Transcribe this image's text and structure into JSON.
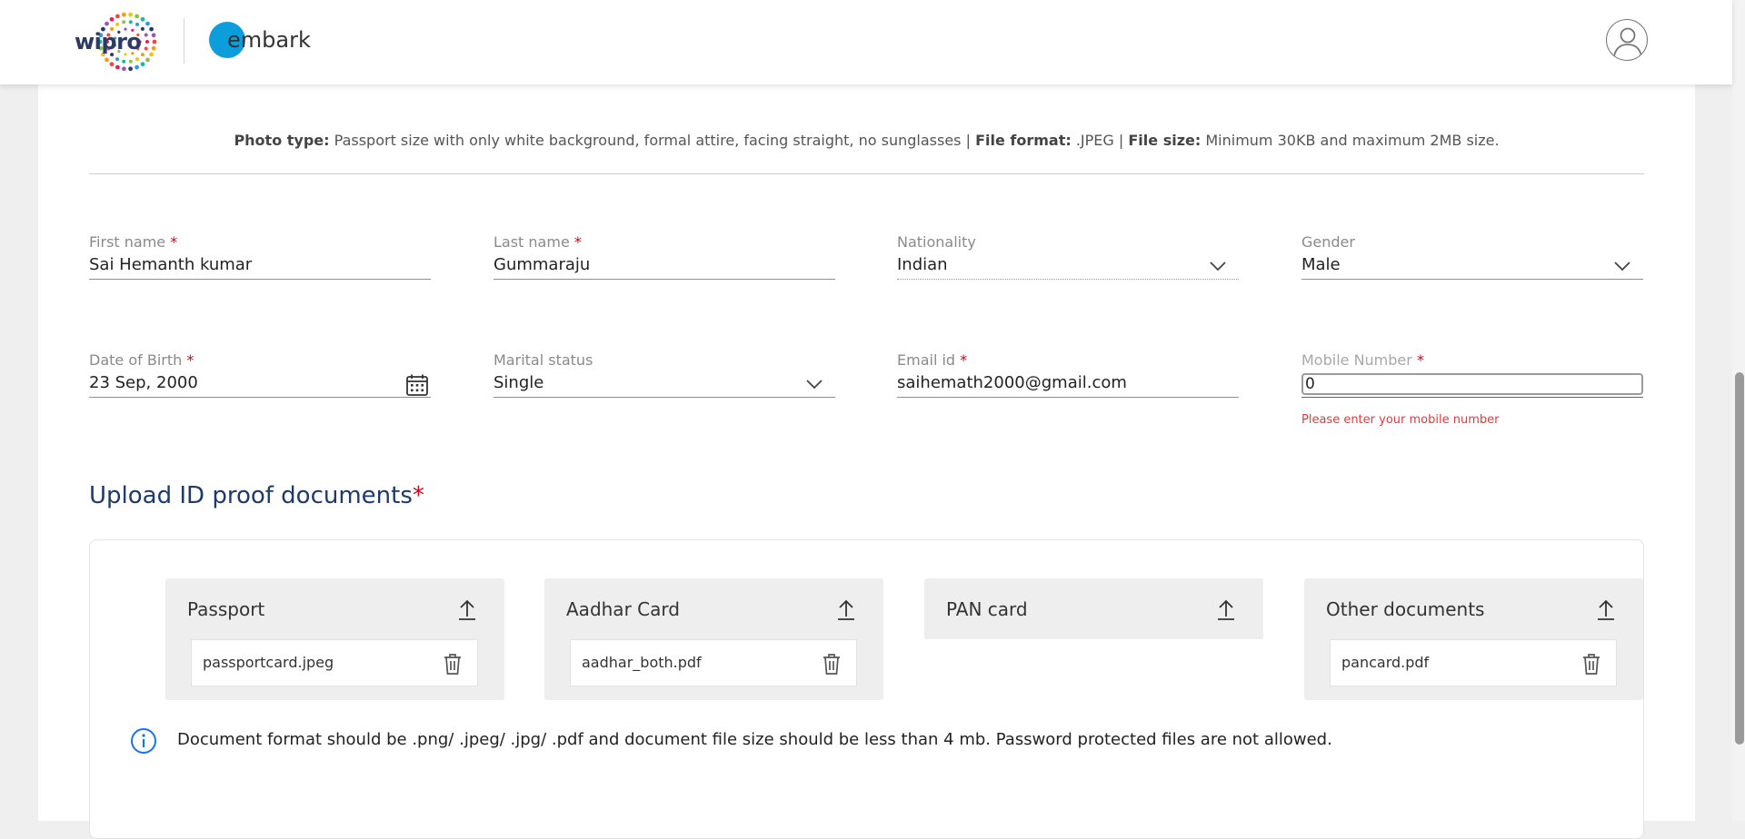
{
  "header": {
    "company_logo_text": "wipro",
    "app_name": "embark",
    "accent_color": "#0d9ddb"
  },
  "photo_note": {
    "type_label": "Photo type:",
    "type_value": "Passport size with only white background, formal attire, facing straight, no sunglasses |",
    "format_label": "File format:",
    "format_value": ".JPEG |",
    "size_label": "File size:",
    "size_value": "Minimum 30KB and maximum 2MB size."
  },
  "form": {
    "first_name": {
      "label": "First name",
      "required_mark": "*",
      "value": "Sai Hemanth kumar"
    },
    "last_name": {
      "label": "Last name",
      "required_mark": "*",
      "value": "Gummaraju"
    },
    "nationality": {
      "label": "Nationality",
      "value": "Indian"
    },
    "gender": {
      "label": "Gender",
      "value": "Male"
    },
    "dob": {
      "label": "Date of Birth",
      "required_mark": "*",
      "value": "23  Sep, 2000"
    },
    "marital_status": {
      "label": "Marital status",
      "value": "Single"
    },
    "email": {
      "label": "Email id",
      "required_mark": "*",
      "value": "saihemath2000@gmail.com"
    },
    "mobile": {
      "label": "Mobile Number",
      "required_mark": "*",
      "value": "0",
      "error": "Please enter your mobile number"
    }
  },
  "upload": {
    "title": "Upload ID proof documents",
    "required_mark": "*",
    "docs": [
      {
        "title": "Passport",
        "file": "passportcard.jpeg"
      },
      {
        "title": "Aadhar Card",
        "file": "aadhar_both.pdf"
      },
      {
        "title": "PAN card"
      },
      {
        "title": "Other documents",
        "file": "pancard.pdf"
      }
    ],
    "info": "Document format should be .png/ .jpeg/ .jpg/ .pdf and document file size should be less than 4 mb. Password protected files are not allowed."
  },
  "icons": {
    "upload": "upload-arrow-icon",
    "delete": "trash-icon",
    "calendar": "calendar-icon",
    "dropdown": "chevron-down-icon",
    "info": "info-icon",
    "profile": "user-avatar-icon"
  },
  "colors": {
    "title_blue": "#1e3a6b",
    "error_red": "#e03b3b",
    "info_blue": "#1a73e8"
  }
}
